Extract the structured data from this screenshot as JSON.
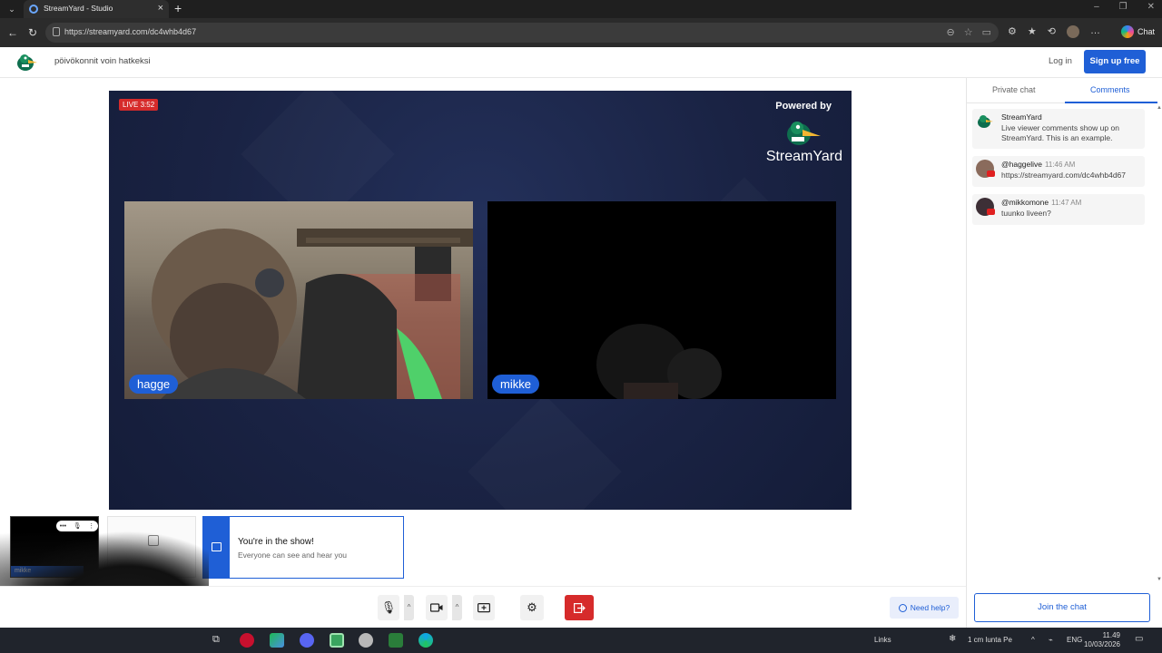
{
  "browser": {
    "tab_title": "StreamYard - Studio",
    "url": "https://streamyard.com/dc4whb4d67",
    "chat_label": "Chat"
  },
  "header": {
    "studio_title": "pöivökonnit voin hatkeksi",
    "login_label": "Log in",
    "signup_label": "Sign up free"
  },
  "stage": {
    "live_badge": "LIVE 3:52",
    "powered_by": "Powered by",
    "brand_name": "StreamYard",
    "participants": [
      {
        "name": "hagge"
      },
      {
        "name": "mikke"
      }
    ]
  },
  "preview": {
    "self_name": "mikke",
    "notice_title": "You're in the show!",
    "notice_subtitle": "Everyone can see and hear you"
  },
  "controls": {
    "help_label": "Need help?"
  },
  "side_panel": {
    "tabs": [
      {
        "label": "Private chat"
      },
      {
        "label": "Comments"
      }
    ],
    "active_tab": "Comments",
    "comments": [
      {
        "author": "StreamYard",
        "time": "",
        "text": "Live viewer comments show up on StreamYard. This is an example."
      },
      {
        "author": "@haggelive",
        "time": "11:46 AM",
        "text": "https://streamyard.com/dc4whb4d67"
      },
      {
        "author": "@mikkomone",
        "time": "11:47 AM",
        "text": "tuunko liveen?"
      }
    ],
    "join_label": "Join the chat"
  },
  "taskbar": {
    "links_label": "Links",
    "weather": "1 cm lunta Pe",
    "language": "ENG",
    "time": "11.49",
    "date": "10/03/2026"
  },
  "colors": {
    "accent": "#1f5fd6",
    "live_red": "#d62b2b",
    "stage_bg": "#1a2344"
  }
}
